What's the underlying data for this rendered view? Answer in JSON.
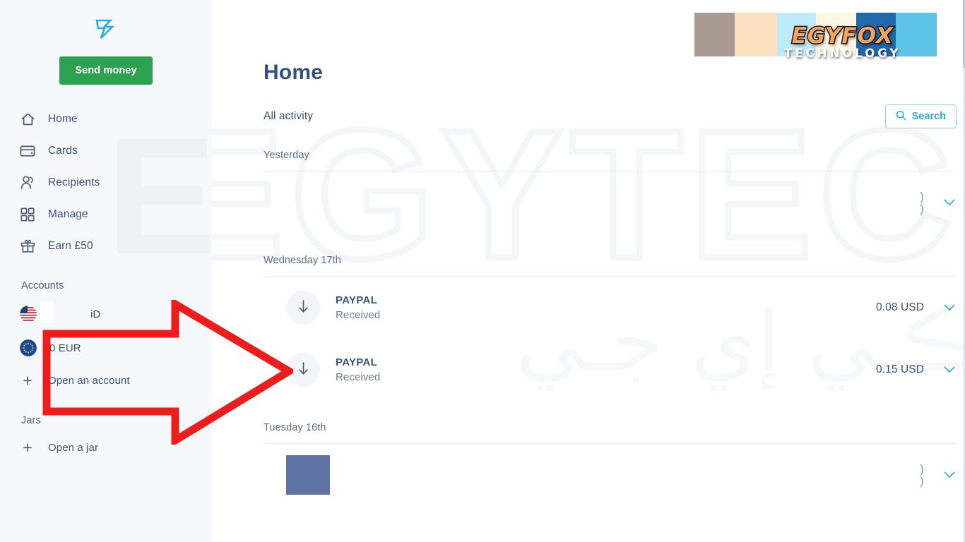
{
  "brand": {
    "logo_name": "wise-logo",
    "logo_color": "#2aabee"
  },
  "sidebar": {
    "send_money_label": "Send money",
    "nav_items": [
      {
        "label": "Home",
        "icon": "home-icon"
      },
      {
        "label": "Cards",
        "icon": "card-icon"
      },
      {
        "label": "Recipients",
        "icon": "recipients-icon"
      },
      {
        "label": "Manage",
        "icon": "grid-icon"
      },
      {
        "label": "Earn £50",
        "icon": "gift-icon"
      }
    ],
    "accounts_heading": "Accounts",
    "accounts": [
      {
        "label": "iD",
        "flag": "us-flag-icon"
      },
      {
        "label": "0 EUR",
        "flag": "eu-flag-icon"
      }
    ],
    "open_account_label": "Open an account",
    "jars_heading": "Jars",
    "open_jar_label": "Open a jar",
    "watermark": "EG"
  },
  "main": {
    "page_title": "Home",
    "activity_label": "All activity",
    "search_label": "Search",
    "search_icon": "search-icon",
    "bell_icon": "notification-bell-icon",
    "watermark": "EGYTECH",
    "watermark_arabic": "ـت ڪـي إي جـي",
    "groups": [
      {
        "day": "Yesterday",
        "rows": [
          {
            "name": "",
            "sub": "",
            "amount_line1": ")",
            "amount_line2": ")",
            "icon": "",
            "redacted": true,
            "chevron": "chevron-down-icon"
          }
        ]
      },
      {
        "day": "Wednesday 17th",
        "rows": [
          {
            "name": "PAYPAL",
            "sub": "Received",
            "amount": "0.08 USD",
            "icon": "arrow-down-icon",
            "redacted": false,
            "chevron": "chevron-down-icon"
          },
          {
            "name": "PAYPAL",
            "sub": "Received",
            "amount": "0.15 USD",
            "icon": "arrow-down-icon",
            "redacted": false,
            "chevron": "chevron-down-icon"
          }
        ]
      },
      {
        "day": "Tuesday 16th",
        "rows": [
          {
            "name": "",
            "sub": "",
            "amount_line1": ")",
            "amount_line2": ")",
            "icon": "redaction-block",
            "redacted": true,
            "chevron": "chevron-down-icon"
          }
        ]
      }
    ]
  },
  "overlay": {
    "arrow_color": "#ee1d1d",
    "arrow_name": "red-annotation-arrow",
    "swatches": [
      "#a89a92",
      "#fbe0c0",
      "#bfeaf7",
      "#fcf6e4",
      "#2169ac",
      "#5dc4e8"
    ],
    "logo_title": "EGYFOX",
    "logo_subtitle": "TECHNOLOGY",
    "logo_title_color": "#f5a45f",
    "logo_sub_color": "#ffffff"
  },
  "colors": {
    "sidebar_bg": "#f6f8fb",
    "accent_green": "#2ca14f",
    "text_navy": "#37517e",
    "accent_cyan": "#2ea9dd"
  }
}
